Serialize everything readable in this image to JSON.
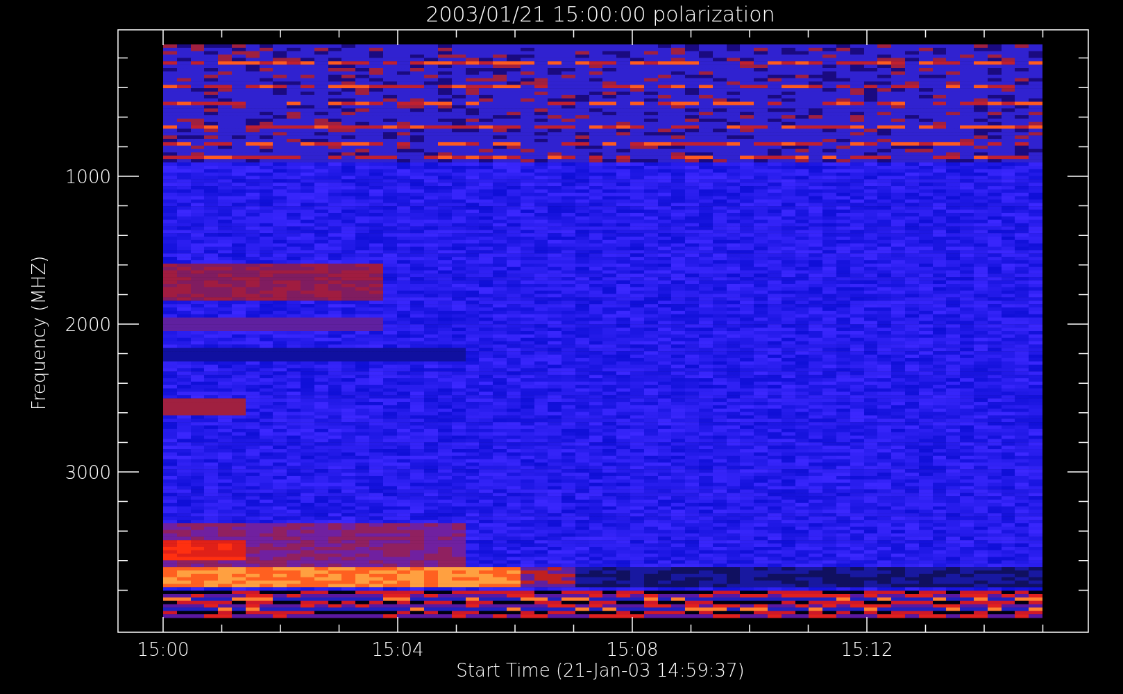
{
  "title": "2003/01/21 15:00:00 polarization",
  "x_axis": {
    "label": "Start Time (21-Jan-03 14:59:37)",
    "tick_labels": [
      "15:00",
      "15:04",
      "15:08",
      "15:12"
    ]
  },
  "y_axis": {
    "label": "Frequency (MHZ)",
    "tick_labels": [
      "1000",
      "2000",
      "3000"
    ]
  }
}
